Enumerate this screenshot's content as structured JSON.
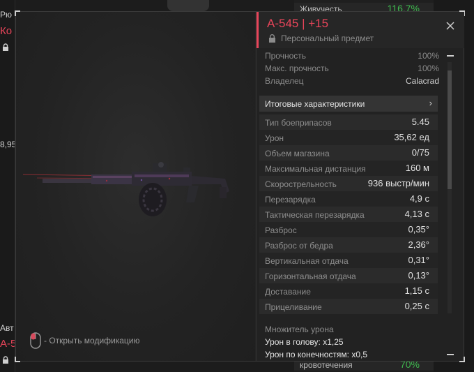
{
  "background": {
    "left_label_1": "Рю",
    "left_label_2": "Ко",
    "left_value": "8,95",
    "left_label_3": "Авт",
    "left_label_4": "А-5",
    "right_rows": [
      {
        "label": "Живучесть",
        "value": "116,7%"
      }
    ],
    "right_bottom_label": "кровотечения",
    "right_bottom_value": "70%"
  },
  "item": {
    "title": "А-545 | +15",
    "subtitle": "Персональный предмет",
    "durability": {
      "label": "Прочность",
      "value": "100%"
    },
    "max_durability": {
      "label": "Макс. прочность",
      "value": "100%"
    },
    "owner": {
      "label": "Владелец",
      "value": "Calacrad"
    },
    "final_stats_label": "Итоговые характеристики",
    "stats": [
      {
        "label": "Тип боеприпасов",
        "value": "5.45"
      },
      {
        "label": "Урон",
        "value": "35,62 ед"
      },
      {
        "label": "Объем магазина",
        "value": "0/75"
      },
      {
        "label": "Максимальная дистанция",
        "value": "160 м"
      },
      {
        "label": "Скорострельность",
        "value": "936 выстр/мин"
      },
      {
        "label": "Перезарядка",
        "value": "4,9 с"
      },
      {
        "label": "Тактическая перезарядка",
        "value": "4,13 с"
      },
      {
        "label": "Разброс",
        "value": "0,35°"
      },
      {
        "label": "Разброс от бедра",
        "value": "2,36°"
      },
      {
        "label": "Вертикальная отдача",
        "value": "0,31°"
      },
      {
        "label": "Горизонтальная отдача",
        "value": "0,13°"
      },
      {
        "label": "Доставание",
        "value": "1,15 с"
      },
      {
        "label": "Прицеливание",
        "value": "0,25 с"
      }
    ],
    "damage_multiplier": {
      "heading": "Множитель урона",
      "head": "Урон в голову: x1,25",
      "limbs": "Урон по конечностям: x0,5"
    }
  },
  "hint": {
    "text": "- Открыть модификацию",
    "icon": "mouse-icon"
  },
  "colors": {
    "accent": "#e8455a",
    "positive": "#3fb94f",
    "panel": "#242424"
  }
}
